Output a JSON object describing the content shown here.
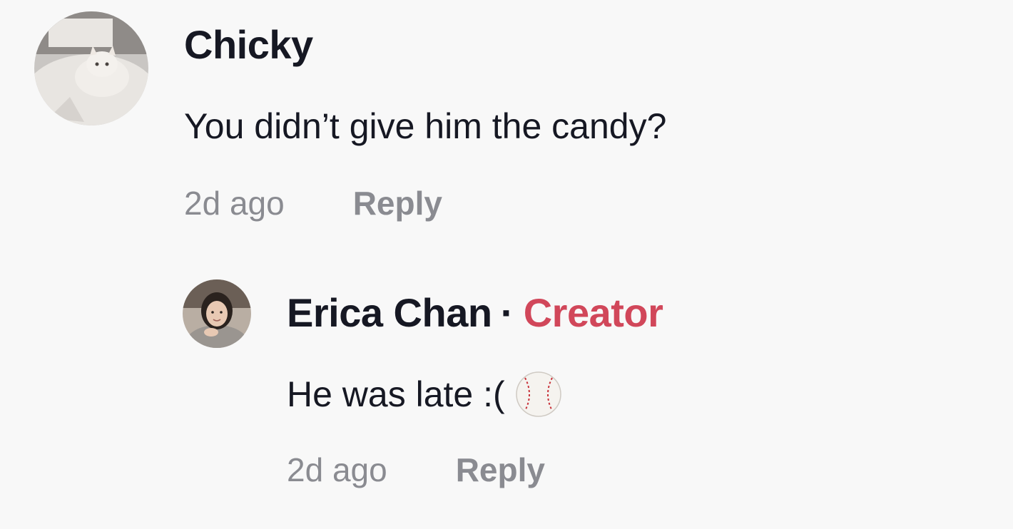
{
  "comments": [
    {
      "username": "Chicky",
      "text": "You didn’t give him the candy?",
      "time": "2d ago",
      "reply_label": "Reply",
      "avatar_icon": "cat-avatar"
    },
    {
      "username": "Erica Chan",
      "separator": "·",
      "badge": "Creator",
      "text": "He was late :(",
      "emoji": "baseball-icon",
      "time": "2d ago",
      "reply_label": "Reply",
      "avatar_icon": "person-avatar"
    }
  ],
  "colors": {
    "background": "#f8f8f8",
    "text": "#161823",
    "muted": "#8a8b91",
    "creator_badge": "#d1475a"
  }
}
